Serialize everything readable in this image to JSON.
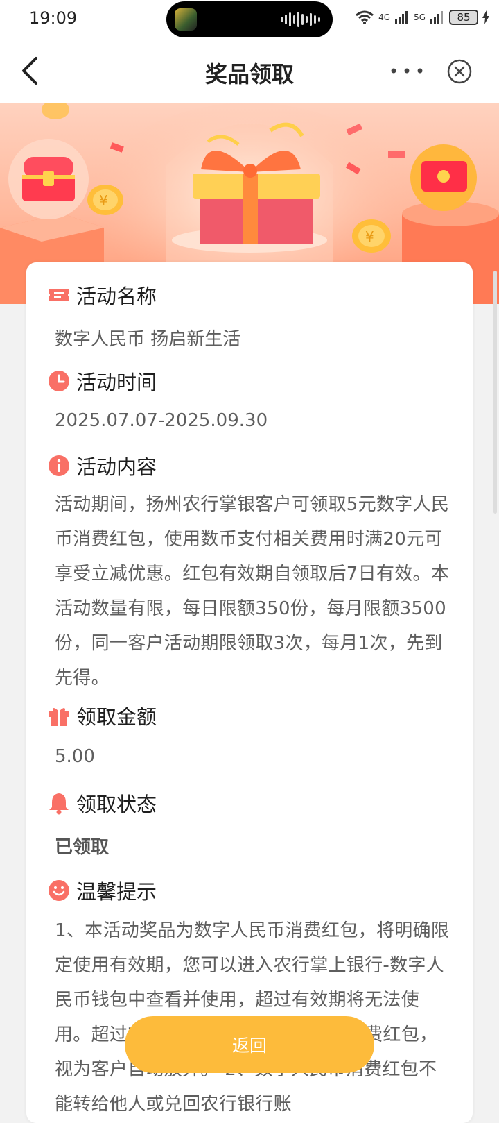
{
  "status_bar": {
    "time": "19:09",
    "network_1": "4G",
    "network_2": "5G",
    "battery": "85"
  },
  "nav": {
    "title": "奖品领取"
  },
  "sections": {
    "name": {
      "title": "活动名称",
      "value": "数字人民币 扬启新生活"
    },
    "time": {
      "title": "活动时间",
      "value": "2025.07.07-2025.09.30"
    },
    "content": {
      "title": "活动内容",
      "value": "活动期间，扬州农行掌银客户可领取5元数字人民币消费红包，使用数币支付相关费用时满20元可享受立减优惠。红包有效期自领取后7日有效。本活动数量有限，每日限额350份，每月限额3500份，同一客户活动期限领取3次，每月1次，先到先得。"
    },
    "amount": {
      "title": "领取金额",
      "value": "5.00"
    },
    "status": {
      "title": "领取状态",
      "value": "已领取"
    },
    "tips": {
      "title": "温馨提示",
      "value": "1、本活动奖品为数字人民币消费红包，将明确限定使用有效期，您可以进入农行掌上银行-数字人民币钱包中查看并使用，超过有效期将无法使用。超过有效期未使用的数字人民币消费红包，视为客户自动放弃。 2、数字人民币消费红包不能转给他人或兑回农行银行账"
    }
  },
  "button": {
    "label": "返回"
  }
}
